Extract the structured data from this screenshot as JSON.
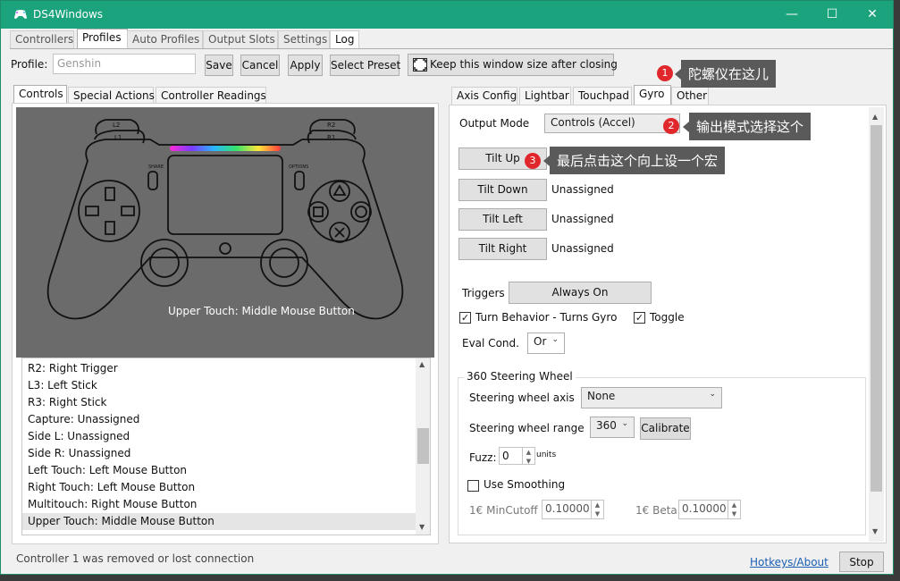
{
  "window": {
    "title": "DS4Windows"
  },
  "top_tabs": [
    "Controllers",
    "Profiles",
    "Auto Profiles",
    "Output Slots",
    "Settings",
    "Log"
  ],
  "profile": {
    "label": "Profile:",
    "name_placeholder": "Genshin",
    "save": "Save",
    "cancel": "Cancel",
    "apply": "Apply",
    "select_preset": "Select Preset",
    "keep_size": "Keep this window size after closing"
  },
  "left_tabs": [
    "Controls",
    "Special Actions",
    "Controller Readings"
  ],
  "controller": {
    "hover_text": "Upper Touch: Middle Mouse Button",
    "labels": {
      "l2": "L2",
      "l1": "L1",
      "r2": "R2",
      "r1": "R1",
      "share": "SHARE",
      "options": "OPTIONS"
    }
  },
  "mapping_list": [
    "R2: Right Trigger",
    "L3: Left Stick",
    "R3: Right Stick",
    "Capture: Unassigned",
    "Side L: Unassigned",
    "Side R: Unassigned",
    "Left Touch: Left Mouse Button",
    "Right Touch: Left Mouse Button",
    "Multitouch: Right Mouse Button",
    "Upper Touch: Middle Mouse Button"
  ],
  "right_tabs": [
    "Axis Config",
    "Lightbar",
    "Touchpad",
    "Gyro",
    "Other"
  ],
  "gyro": {
    "output_mode_label": "Output Mode",
    "output_mode_value": "Controls (Accel)",
    "tilt": [
      {
        "button": "Tilt Up",
        "value": ""
      },
      {
        "button": "Tilt Down",
        "value": "Unassigned"
      },
      {
        "button": "Tilt Left",
        "value": "Unassigned"
      },
      {
        "button": "Tilt Right",
        "value": "Unassigned"
      }
    ],
    "triggers_label": "Triggers",
    "triggers_value": "Always On",
    "turn_behavior": "Turn Behavior - Turns Gyro",
    "toggle": "Toggle",
    "eval_cond_label": "Eval Cond.",
    "eval_cond_value": "Or",
    "steering": {
      "group_title": "360 Steering Wheel",
      "axis_label": "Steering wheel axis",
      "axis_value": "None",
      "range_label": "Steering wheel range",
      "range_value": "360",
      "calibrate": "Calibrate",
      "fuzz_label": "Fuzz:",
      "fuzz_value": "0",
      "fuzz_unit": "units",
      "use_smoothing": "Use Smoothing",
      "mincutoff_label": "1€ MinCutoff",
      "mincutoff_value": "0.10000",
      "beta_label": "1€ Beta",
      "beta_value": "0.10000"
    }
  },
  "annotations": [
    {
      "num": "1",
      "text": "陀螺仪在这儿"
    },
    {
      "num": "2",
      "text": "输出模式选择这个"
    },
    {
      "num": "3",
      "text": "最后点击这个向上设一个宏"
    }
  ],
  "status": {
    "text": "Controller 1 was removed or lost connection",
    "hotkeys": "Hotkeys/About",
    "stop": "Stop"
  },
  "colors": {
    "titlebar": "#1aa37d",
    "badge": "#e0272b",
    "annotation_bg": "#5a5a5a"
  }
}
